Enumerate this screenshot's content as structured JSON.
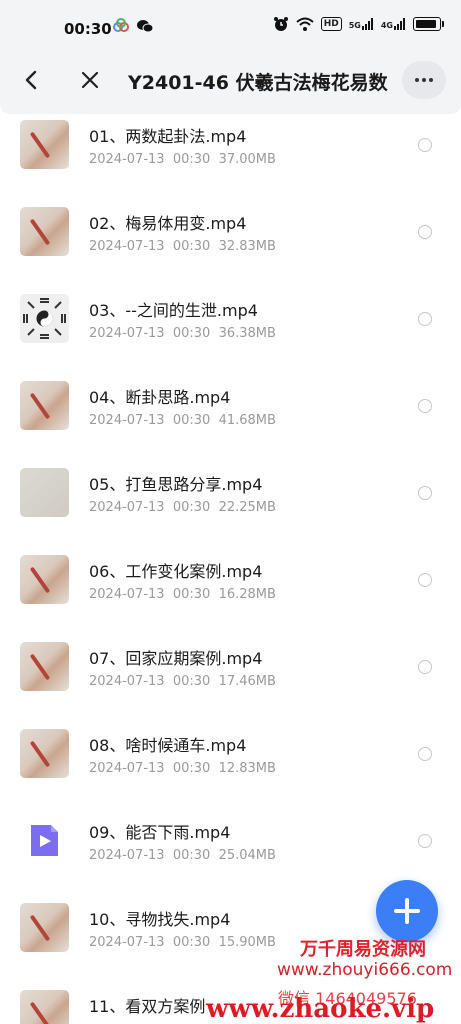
{
  "status_bar": {
    "time": "00:30",
    "app_icons": [
      "chat-bubble-icon",
      "cloud-app-icon"
    ],
    "hd_badge": "HD",
    "network_1": "5G",
    "network_2": "4G",
    "battery_icon": "battery-icon"
  },
  "header": {
    "title": "Y2401-46 伏羲古法梅花易数",
    "back_icon": "chevron-left-icon",
    "close_icon": "close-icon",
    "more_icon": "more-horizontal-icon"
  },
  "files": [
    {
      "name": "01、两数起卦法.mp4",
      "date": "2024-07-13",
      "time": "00:30",
      "size": "37.00MB",
      "thumb": "hand"
    },
    {
      "name": "02、梅易体用变.mp4",
      "date": "2024-07-13",
      "time": "00:30",
      "size": "32.83MB",
      "thumb": "hand"
    },
    {
      "name": "03、--之间的生泄.mp4",
      "date": "2024-07-13",
      "time": "00:30",
      "size": "36.38MB",
      "thumb": "bagua"
    },
    {
      "name": "04、断卦思路.mp4",
      "date": "2024-07-13",
      "time": "00:30",
      "size": "41.68MB",
      "thumb": "hand"
    },
    {
      "name": "05、打鱼思路分享.mp4",
      "date": "2024-07-13",
      "time": "00:30",
      "size": "22.25MB",
      "thumb": "paper"
    },
    {
      "name": "06、工作变化案例.mp4",
      "date": "2024-07-13",
      "time": "00:30",
      "size": "16.28MB",
      "thumb": "hand"
    },
    {
      "name": "07、回家应期案例.mp4",
      "date": "2024-07-13",
      "time": "00:30",
      "size": "17.46MB",
      "thumb": "hand"
    },
    {
      "name": "08、啥时候通车.mp4",
      "date": "2024-07-13",
      "time": "00:30",
      "size": "12.83MB",
      "thumb": "hand"
    },
    {
      "name": "09、能否下雨.mp4",
      "date": "2024-07-13",
      "time": "00:30",
      "size": "25.04MB",
      "thumb": "video"
    },
    {
      "name": "10、寻物找失.mp4",
      "date": "2024-07-13",
      "time": "00:30",
      "size": "15.90MB",
      "thumb": "hand"
    },
    {
      "name": "11、看双方案例",
      "date": "",
      "time": "",
      "size": "",
      "thumb": "hand"
    }
  ],
  "fab": {
    "icon": "plus-icon"
  },
  "watermark": {
    "line1": "万千周易资源网",
    "line2": "www.zhouyi666.com",
    "line3": "微信 1464049576",
    "line4": "www.zhaoke.vip"
  },
  "colors": {
    "accent": "#3c7ef5",
    "watermark": "#e4202a",
    "header_bg": "#f3f4f6",
    "meta_text": "#9a9a9a"
  }
}
